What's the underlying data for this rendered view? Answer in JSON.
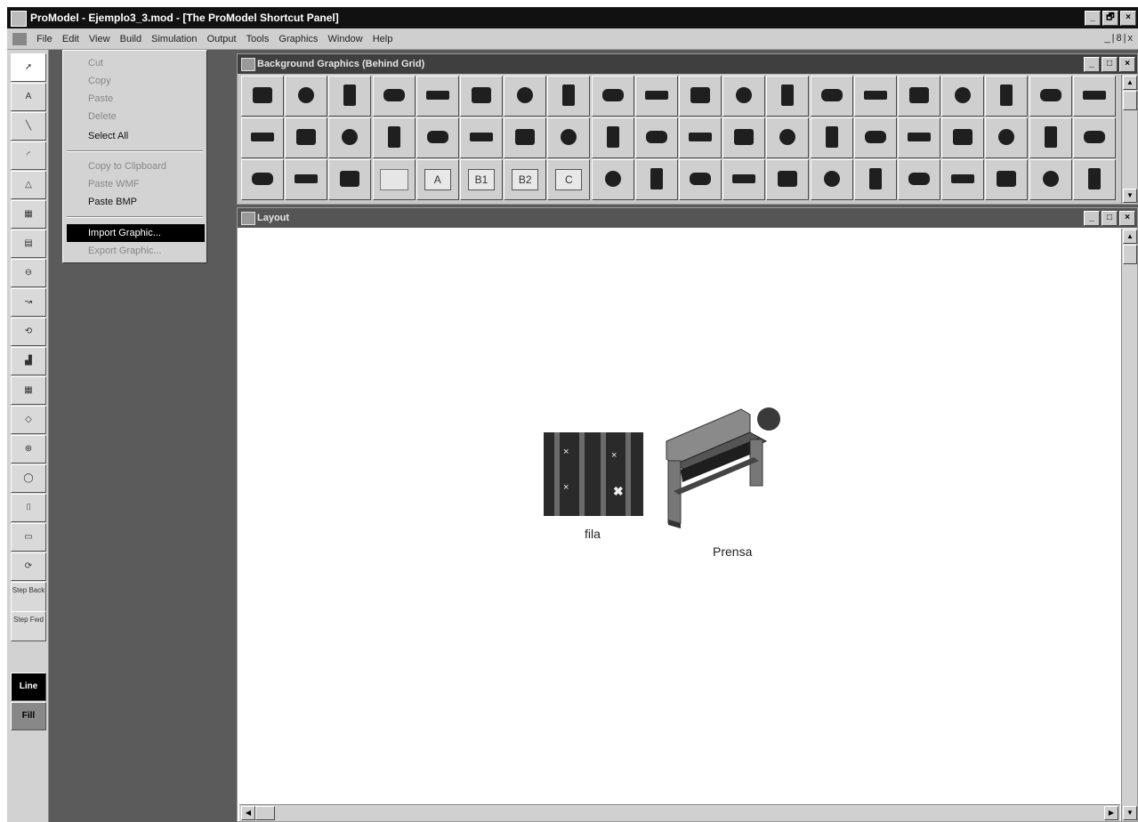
{
  "app": {
    "title": "ProModel - Ejemplo3_3.mod - [The ProModel Shortcut Panel]"
  },
  "window_buttons": {
    "minimize": "_",
    "restore": "🗗",
    "close": "×"
  },
  "menubar": {
    "items": [
      "File",
      "Edit",
      "View",
      "Build",
      "Simulation",
      "Output",
      "Tools",
      "Graphics",
      "Window",
      "Help"
    ],
    "mdi_buttons": "_|8|x"
  },
  "edit_menu": {
    "items": [
      {
        "label": "Cut",
        "enabled": false
      },
      {
        "label": "Copy",
        "enabled": false
      },
      {
        "label": "Paste",
        "enabled": false
      },
      {
        "label": "Delete",
        "enabled": false
      },
      {
        "label": "Select All",
        "enabled": true
      },
      {
        "label": "Copy to Clipboard",
        "enabled": false
      },
      {
        "label": "Paste WMF",
        "enabled": false
      },
      {
        "label": "Paste BMP",
        "enabled": true
      },
      {
        "label": "Import Graphic...",
        "enabled": true,
        "highlighted": true
      },
      {
        "label": "Export Graphic...",
        "enabled": false
      }
    ]
  },
  "toolbar": {
    "tools": [
      "pointer-icon",
      "text-icon",
      "line-icon",
      "arc-icon",
      "triangle-icon",
      "grid-icon",
      "grid2-icon",
      "conveyor-icon",
      "path-icon",
      "loop-icon",
      "chart-icon",
      "table-icon",
      "compass-icon",
      "target-icon",
      "ellipse-icon",
      "door-icon",
      "monitor-icon",
      "rotate-icon"
    ],
    "step_back": "Step Back",
    "step_fwd": "Step Fwd",
    "line": "Line",
    "fill": "Fill"
  },
  "background_window": {
    "title": "Background Graphics (Behind Grid)",
    "palette_text": [
      "A",
      "B1",
      "B2",
      "C"
    ]
  },
  "layout_window": {
    "title": "Layout",
    "fila_label": "fila",
    "prensa_label": "Prensa"
  },
  "colors": {
    "titlebar": "#111111",
    "workspace": "#5b5b5b",
    "subtitle_bar": "#3f3f3f"
  }
}
